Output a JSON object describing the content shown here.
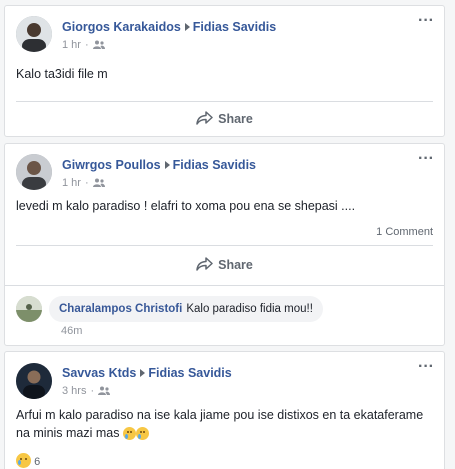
{
  "posts": [
    {
      "author": "Giorgos Karakaidos",
      "target": "Fidias Savidis",
      "time": "1 hr",
      "text": "Kalo ta3idi file m",
      "share_label": "Share"
    },
    {
      "author": "Giwrgos Poullos",
      "target": "Fidias Savidis",
      "time": "1 hr",
      "text": "levedi m kalo paradiso ! elafri to xoma pou ena se shepasi ....",
      "comment_count": "1 Comment",
      "share_label": "Share",
      "comment": {
        "author": "Charalampos Christofi",
        "text": "Kalo paradiso fidia mou!!",
        "time": "46m"
      }
    },
    {
      "author": "Savvas Ktds",
      "target": "Fidias Savidis",
      "time": "3 hrs",
      "text_line1": "Arfui m kalo paradiso na ise kala jiame pou ise distixos en ta ekataferame",
      "text_line2": "na minis mazi mas",
      "reaction_count": "6"
    }
  ],
  "icons": {
    "more": "more-options-icon",
    "audience": "friends-audience-icon",
    "share": "share-arrow-icon",
    "reaction": "sad-reaction-icon"
  },
  "colors": {
    "link": "#365899",
    "meta": "#90949c",
    "border": "#dddfe2",
    "background": "#f5f6f7"
  }
}
